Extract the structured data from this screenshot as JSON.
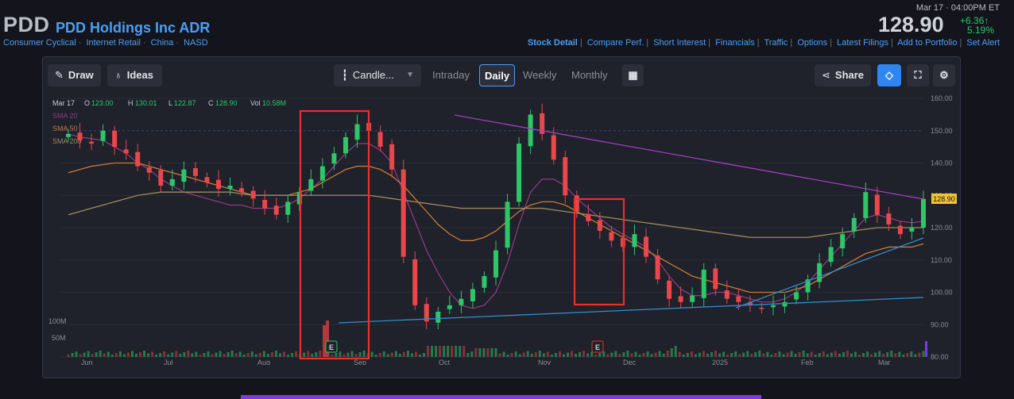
{
  "header": {
    "ticker": "PDD",
    "company": "PDD Holdings Inc ADR",
    "sector_links": [
      "Consumer Cyclical",
      "Internet Retail",
      "China",
      "NASD"
    ],
    "quote_time": "Mar 17 · 04:00PM ET",
    "price": "128.90",
    "change": "+6.36↑",
    "change_pct": "5.19%",
    "nav_links": [
      "Stock Detail",
      "Compare Perf.",
      "Short Interest",
      "Financials",
      "Traffic",
      "Options",
      "Latest Filings",
      "Add to Portfolio",
      "Set Alert"
    ]
  },
  "toolbar": {
    "draw_label": "Draw",
    "ideas_label": "Ideas",
    "chart_type_label": "Candle...",
    "timeframes": [
      "Intraday",
      "Daily",
      "Weekly",
      "Monthly"
    ],
    "active_timeframe": "Daily",
    "share_label": "Share"
  },
  "chart_data": {
    "type": "candlestick",
    "ohlc": {
      "date": "Mar 17",
      "O": "123.00",
      "H": "130.01",
      "L": "122.87",
      "C": "128.90",
      "Vol": "10.58M"
    },
    "legend": [
      "SMA 20",
      "SMA 50",
      "SMA 200"
    ],
    "legend_colors": [
      "#8e3a7f",
      "#c97a36",
      "#a08a5c"
    ],
    "y_ticks": [
      "160.00",
      "150.00",
      "140.00",
      "130.00",
      "120.00",
      "110.00",
      "100.00",
      "90.00",
      "80.00"
    ],
    "ylim": [
      80,
      160
    ],
    "x_ticks": [
      "Jun",
      "Jul",
      "Aug",
      "Sep",
      "Oct",
      "Nov",
      "Dec",
      "2025",
      "Feb",
      "Mar"
    ],
    "volume_ticks": [
      "100M",
      "50M"
    ],
    "last_price_tag": "128.90",
    "earnings_markers": [
      "E",
      "E"
    ],
    "closes": [
      149,
      147,
      146,
      150,
      145,
      143,
      139,
      137,
      133,
      135,
      138,
      136,
      134,
      132,
      133,
      131,
      129,
      126,
      124,
      128,
      131,
      135,
      139,
      143,
      148,
      152,
      150,
      145,
      138,
      111,
      96,
      91,
      94,
      96,
      98,
      101,
      105,
      113,
      128,
      146,
      155,
      149,
      141,
      130,
      125,
      122,
      119,
      116,
      114,
      118,
      111,
      104,
      98,
      97,
      99,
      107,
      101,
      98,
      97,
      96,
      95,
      96,
      97,
      100,
      104,
      109,
      114,
      118,
      123,
      131,
      124,
      121,
      118,
      120,
      128.9
    ],
    "sma20": [
      149,
      148,
      147.5,
      147,
      145,
      143,
      140,
      138,
      135,
      133,
      131,
      130,
      129,
      128,
      127,
      127,
      126,
      126,
      126,
      127,
      129,
      132,
      135,
      139,
      143,
      146,
      146,
      144,
      140,
      131,
      122,
      113,
      106,
      100,
      96,
      95,
      96,
      100,
      109,
      121,
      131,
      135,
      135,
      133,
      129,
      126,
      123,
      120,
      118,
      116,
      114,
      110,
      105,
      101,
      99,
      99,
      100,
      100,
      99,
      98,
      97,
      97,
      98,
      100,
      103,
      107,
      111,
      115,
      119,
      123,
      124,
      123,
      122,
      121.5,
      122
    ],
    "sma50": [
      137,
      138,
      139,
      139.5,
      140,
      140,
      140,
      139,
      138,
      137,
      136,
      135,
      134,
      133,
      132,
      131,
      130,
      130,
      130,
      130,
      131,
      132,
      134,
      136,
      138,
      139,
      139,
      138,
      136,
      133,
      129,
      125,
      121,
      118,
      116,
      116,
      117,
      119,
      122,
      125,
      127,
      128,
      128,
      127,
      125,
      123,
      121,
      119,
      117,
      115,
      113,
      111,
      109,
      107,
      105,
      104,
      103,
      102,
      101,
      100,
      100,
      100,
      100,
      101,
      102,
      104,
      106,
      108,
      110,
      112,
      113,
      114,
      114,
      114,
      115
    ],
    "sma200": [
      124,
      125,
      126,
      127,
      128,
      129,
      130,
      130.5,
      131,
      131,
      131,
      131,
      131,
      131,
      131,
      130.5,
      130,
      130,
      130,
      130,
      130,
      130,
      130,
      130,
      130,
      130,
      130,
      129.5,
      129,
      128.5,
      128,
      127.5,
      127,
      126.5,
      126,
      126,
      126,
      126,
      126,
      126,
      126,
      126,
      125.5,
      125,
      124.5,
      124,
      123.5,
      123,
      122.5,
      122,
      121.5,
      121,
      120.5,
      120,
      119.5,
      119,
      118.5,
      118,
      117.5,
      117,
      117,
      117,
      117,
      117,
      117,
      117.5,
      118,
      118.5,
      119,
      119.5,
      120,
      120,
      120,
      120,
      120
    ]
  }
}
